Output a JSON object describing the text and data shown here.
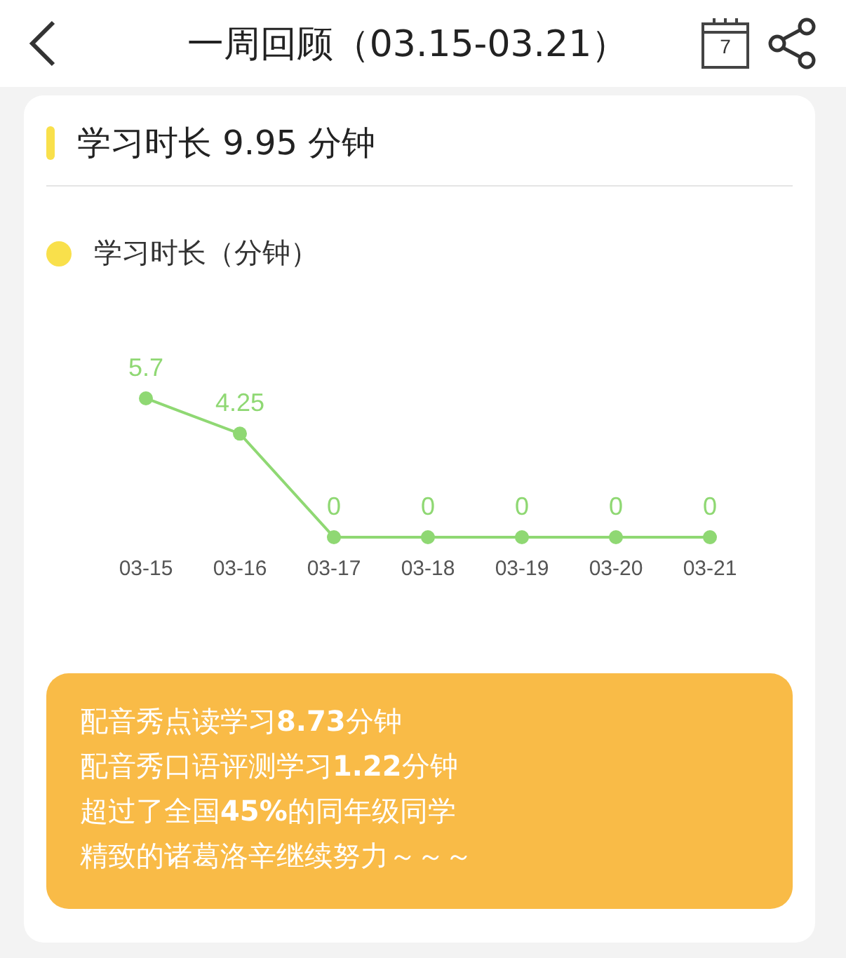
{
  "header": {
    "title": "一周回顾（03.15-03.21）",
    "calendar_day": "7"
  },
  "card": {
    "title": "学习时长 9.95 分钟",
    "chart_data": {
      "type": "line",
      "categories": [
        "03-15",
        "03-16",
        "03-17",
        "03-18",
        "03-19",
        "03-20",
        "03-21"
      ],
      "series": [
        {
          "name": "学习时长（分钟）",
          "color": "#8fd873",
          "marker": "circle",
          "values": [
            5.7,
            4.25,
            0,
            0,
            0,
            0,
            0
          ]
        }
      ],
      "data_labels": true
    },
    "summary": [
      "配音秀点读学习**8.73**分钟",
      "配音秀口语评测学习**1.22**分钟",
      "超过了全国**45%**的同年级同学",
      "精致的诸葛洛辛继续努力～～～"
    ]
  }
}
